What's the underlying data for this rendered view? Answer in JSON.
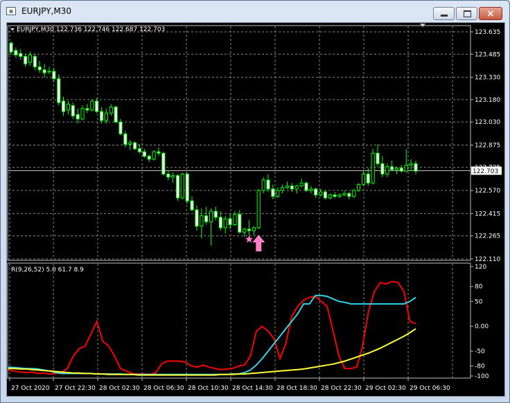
{
  "window": {
    "title": "EURJPY,M30",
    "icon_name": "chart-window-icon",
    "min_icon": "minimize-icon",
    "max_icon": "maximize-icon",
    "close_icon": "close-icon"
  },
  "price_panel": {
    "header": "EURJPY,M30  122.736 122.746 122.687 122.703",
    "current_price": "122.703",
    "colors": {
      "background": "#000000",
      "candle_up": "#000000",
      "candle_down": "#ffffff",
      "wick": "#00ff00",
      "grid": "#c0c0c0",
      "text": "#ffffff",
      "current_line": "#c0c0c0",
      "marker": "#ff7fc8"
    },
    "y_ticks": [
      "123.635",
      "123.485",
      "123.330",
      "123.180",
      "123.030",
      "122.875",
      "122.725",
      "122.570",
      "122.415",
      "122.265",
      "122.110"
    ],
    "marker_icons": [
      "star-icon",
      "arrow-up-icon"
    ]
  },
  "indicator_panel": {
    "header": "R(9,26,52) 5.0 61.7 8.9",
    "y_ticks": [
      "120",
      "80",
      "50",
      "0.00",
      "-50",
      "-80",
      "-100"
    ],
    "colors": {
      "line1": "#ff0000",
      "line2": "#33d6e8",
      "line3": "#ffff33"
    }
  },
  "x_ticks": [
    "27 Oct 2020",
    "27 Oct 22:30",
    "28 Oct 02:30",
    "28 Oct 06:30",
    "28 Oct 10:30",
    "28 Oct 14:30",
    "28 Oct 18:30",
    "28 Oct 22:30",
    "29 Oct 02:30",
    "29 Oct 06:30"
  ],
  "chart_data": [
    {
      "type": "candlestick",
      "symbol": "EURJPY",
      "timeframe": "M30",
      "ylim": [
        122.11,
        123.635
      ],
      "ohlc": [
        [
          123.56,
          123.57,
          123.48,
          123.5
        ],
        [
          123.51,
          123.53,
          123.46,
          123.48
        ],
        [
          123.49,
          123.52,
          123.45,
          123.47
        ],
        [
          123.47,
          123.49,
          123.4,
          123.42
        ],
        [
          123.43,
          123.5,
          123.41,
          123.48
        ],
        [
          123.47,
          123.49,
          123.38,
          123.4
        ],
        [
          123.4,
          123.44,
          123.36,
          123.38
        ],
        [
          123.38,
          123.42,
          123.33,
          123.36
        ],
        [
          123.37,
          123.4,
          123.35,
          123.37
        ],
        [
          123.37,
          123.39,
          123.3,
          123.32
        ],
        [
          123.32,
          123.35,
          123.14,
          123.16
        ],
        [
          123.17,
          123.2,
          123.07,
          123.1
        ],
        [
          123.11,
          123.17,
          123.08,
          123.15
        ],
        [
          123.14,
          123.16,
          123.05,
          123.07
        ],
        [
          123.08,
          123.12,
          123.02,
          123.05
        ],
        [
          123.05,
          123.14,
          123.04,
          123.12
        ],
        [
          123.12,
          123.15,
          123.09,
          123.11
        ],
        [
          123.11,
          123.18,
          123.1,
          123.17
        ],
        [
          123.17,
          123.19,
          123.09,
          123.1
        ],
        [
          123.1,
          123.13,
          123.02,
          123.04
        ],
        [
          123.04,
          123.12,
          123.02,
          123.09
        ],
        [
          123.09,
          123.15,
          123.07,
          123.13
        ],
        [
          123.13,
          123.14,
          123.02,
          123.03
        ],
        [
          123.03,
          123.05,
          122.94,
          122.95
        ],
        [
          122.95,
          122.97,
          122.86,
          122.88
        ],
        [
          122.88,
          122.91,
          122.84,
          122.89
        ],
        [
          122.89,
          122.9,
          122.84,
          122.85
        ],
        [
          122.85,
          122.88,
          122.82,
          122.83
        ],
        [
          122.83,
          122.85,
          122.79,
          122.8
        ],
        [
          122.8,
          122.81,
          122.76,
          122.78
        ],
        [
          122.78,
          122.84,
          122.77,
          122.83
        ],
        [
          122.83,
          122.86,
          122.8,
          122.82
        ],
        [
          122.82,
          122.83,
          122.67,
          122.68
        ],
        [
          122.68,
          122.7,
          122.64,
          122.66
        ],
        [
          122.66,
          122.69,
          122.62,
          122.67
        ],
        [
          122.67,
          122.68,
          122.5,
          122.52
        ],
        [
          122.52,
          122.69,
          122.51,
          122.68
        ],
        [
          122.68,
          122.69,
          122.48,
          122.5
        ],
        [
          122.5,
          122.53,
          122.43,
          122.44
        ],
        [
          122.44,
          122.47,
          122.3,
          122.33
        ],
        [
          122.33,
          122.45,
          122.25,
          122.4
        ],
        [
          122.4,
          122.46,
          122.34,
          122.36
        ],
        [
          122.36,
          122.45,
          122.2,
          122.43
        ],
        [
          122.43,
          122.46,
          122.37,
          122.39
        ],
        [
          122.39,
          122.43,
          122.3,
          122.32
        ],
        [
          122.32,
          122.4,
          122.28,
          122.38
        ],
        [
          122.38,
          122.41,
          122.31,
          122.34
        ],
        [
          122.34,
          122.43,
          122.33,
          122.41
        ],
        [
          122.41,
          122.44,
          122.28,
          122.29
        ],
        [
          122.29,
          122.32,
          122.26,
          122.31
        ],
        [
          122.31,
          122.37,
          122.27,
          122.3
        ],
        [
          122.3,
          122.33,
          122.27,
          122.32
        ],
        [
          122.32,
          122.58,
          122.31,
          122.57
        ],
        [
          122.57,
          122.66,
          122.55,
          122.64
        ],
        [
          122.64,
          122.68,
          122.56,
          122.58
        ],
        [
          122.58,
          122.61,
          122.51,
          122.53
        ],
        [
          122.53,
          122.59,
          122.52,
          122.57
        ],
        [
          122.57,
          122.61,
          122.55,
          122.59
        ],
        [
          122.59,
          122.63,
          122.58,
          122.6
        ],
        [
          122.6,
          122.62,
          122.56,
          122.58
        ],
        [
          122.58,
          122.61,
          122.55,
          122.6
        ],
        [
          122.6,
          122.65,
          122.59,
          122.62
        ],
        [
          122.62,
          122.63,
          122.56,
          122.57
        ],
        [
          122.57,
          122.6,
          122.55,
          122.58
        ],
        [
          122.58,
          122.59,
          122.52,
          122.54
        ],
        [
          122.54,
          122.58,
          122.53,
          122.56
        ],
        [
          122.56,
          122.57,
          122.51,
          122.52
        ],
        [
          122.52,
          122.55,
          122.51,
          122.54
        ],
        [
          122.54,
          122.56,
          122.52,
          122.53
        ],
        [
          122.53,
          122.55,
          122.52,
          122.54
        ],
        [
          122.54,
          122.57,
          122.53,
          122.55
        ],
        [
          122.55,
          122.56,
          122.51,
          122.53
        ],
        [
          122.53,
          122.58,
          122.52,
          122.57
        ],
        [
          122.57,
          122.62,
          122.56,
          122.61
        ],
        [
          122.61,
          122.7,
          122.6,
          122.68
        ],
        [
          122.68,
          122.72,
          122.6,
          122.62
        ],
        [
          122.62,
          122.85,
          122.61,
          122.82
        ],
        [
          122.82,
          122.88,
          122.73,
          122.75
        ],
        [
          122.75,
          122.8,
          122.66,
          122.68
        ],
        [
          122.68,
          122.75,
          122.66,
          122.73
        ],
        [
          122.73,
          122.77,
          122.7,
          122.71
        ],
        [
          122.71,
          122.73,
          122.68,
          122.72
        ],
        [
          122.72,
          122.74,
          122.69,
          122.7
        ],
        [
          122.7,
          122.85,
          122.69,
          122.74
        ],
        [
          122.74,
          122.78,
          122.7,
          122.75
        ],
        [
          122.75,
          122.77,
          122.68,
          122.7
        ]
      ],
      "current_price": 122.703,
      "markers": [
        {
          "type": "star",
          "index": 50
        },
        {
          "type": "arrow-up",
          "index": 52
        }
      ]
    },
    {
      "type": "line",
      "ylim": [
        -100,
        120
      ],
      "series": [
        {
          "name": "",
          "color": "#ff0000",
          "values": [
            -88,
            -90,
            -92,
            -93,
            -92,
            -95,
            -94,
            -96,
            -95,
            -93,
            -85,
            -60,
            -45,
            -40,
            -15,
            10,
            -30,
            -40,
            -60,
            -85,
            -90,
            -95,
            -96,
            -96,
            -97,
            -93,
            -75,
            -70,
            -70,
            -70,
            -72,
            -80,
            -82,
            -78,
            -82,
            -85,
            -87,
            -86,
            -85,
            -80,
            -78,
            -60,
            -10,
            0,
            -10,
            -25,
            -65,
            -35,
            20,
            40,
            52,
            58,
            60,
            50,
            40,
            -10,
            -60,
            -85,
            -85,
            -82,
            -40,
            30,
            70,
            88,
            85,
            90,
            88,
            70,
            10,
            5
          ]
        },
        {
          "name": "",
          "color": "#33d6e8",
          "values": [
            -82,
            -83,
            -84,
            -85,
            -85,
            -86,
            -88,
            -90,
            -93,
            -95,
            -95,
            -95,
            -95,
            -95,
            -95,
            -96,
            -96,
            -96,
            -96,
            -96,
            -97,
            -97,
            -97,
            -97,
            -97,
            -97,
            -97,
            -97,
            -97,
            -97,
            -97,
            -97,
            -97,
            -97,
            -97,
            -97,
            -97,
            -97,
            -96,
            -96,
            -93,
            -88,
            -78,
            -65,
            -50,
            -35,
            -20,
            -5,
            10,
            25,
            45,
            45,
            62,
            62,
            60,
            55,
            50,
            48,
            45,
            45,
            45,
            45,
            45,
            45,
            45,
            45,
            45,
            45,
            50,
            58
          ]
        },
        {
          "name": "",
          "color": "#ffff33",
          "values": [
            -85,
            -85,
            -86,
            -86,
            -87,
            -88,
            -89,
            -90,
            -91,
            -92,
            -93,
            -94,
            -94,
            -95,
            -95,
            -96,
            -96,
            -97,
            -97,
            -97,
            -97,
            -97,
            -98,
            -98,
            -98,
            -98,
            -98,
            -98,
            -98,
            -98,
            -98,
            -98,
            -98,
            -98,
            -98,
            -98,
            -97,
            -97,
            -97,
            -96,
            -96,
            -95,
            -94,
            -93,
            -92,
            -91,
            -90,
            -89,
            -88,
            -87,
            -86,
            -84,
            -82,
            -80,
            -78,
            -76,
            -73,
            -70,
            -66,
            -62,
            -58,
            -54,
            -49,
            -44,
            -38,
            -32,
            -26,
            -20,
            -13,
            -5
          ]
        }
      ]
    }
  ]
}
